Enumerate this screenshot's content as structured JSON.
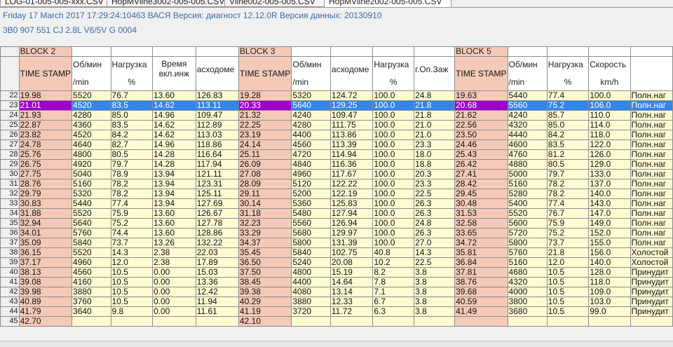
{
  "tabs": [
    "LOG-01-005-005-xxx.CSV",
    "HopMVline3002-005-005.CSV",
    "Vline002-005-005.CSV",
    "HopMVline2002-005-005.CSV"
  ],
  "info_line1": "Friday 17 March 2017 17:29:24:10463 ВАСЯ Версия: диагност 12.12.0R Версия данных: 20130910",
  "info_line2": "3B0 907 551 CJ  2.8L V6/5V     G   0004",
  "blocks": [
    "BLOCK 2",
    "BLOCK 3",
    "BLOCK 5"
  ],
  "time_label": "TIME STAMP",
  "columns": [
    {
      "name": "Об/мин",
      "unit": "/min"
    },
    {
      "name": "Нагрузка",
      "unit": "%"
    },
    {
      "name": "Время вкл.инж",
      "unit": ""
    },
    {
      "name": "асходоме",
      "unit": ""
    },
    {
      "name": "Об/мин",
      "unit": "/min"
    },
    {
      "name": "асходоме",
      "unit": ""
    },
    {
      "name": "Нагрузка",
      "unit": "%"
    },
    {
      "name": "г.Оп.Заж",
      "unit": ""
    },
    {
      "name": "Об/мин",
      "unit": "/min"
    },
    {
      "name": "Нагрузка",
      "unit": "%"
    },
    {
      "name": "Скорость",
      "unit": "km/h"
    }
  ],
  "selected_row": 23,
  "rows": [
    {
      "n": "22",
      "c": [
        "19.98",
        "5520",
        "76.7",
        "13.60",
        "126.83",
        "19.28",
        "5320",
        "124.72",
        "100.0",
        "24.8",
        "19.63",
        "5440",
        "77.4",
        "100.0",
        "Полн.наг"
      ]
    },
    {
      "n": "23",
      "c": [
        "21.01",
        "4520",
        "83.5",
        "14.62",
        "113.11",
        "20.33",
        "5640",
        "129.25",
        "100.0",
        "21.8",
        "20.68",
        "5560",
        "75.2",
        "106.0",
        "Полн.наг"
      ]
    },
    {
      "n": "24",
      "c": [
        "21.93",
        "4280",
        "85.0",
        "14.96",
        "109.47",
        "21.32",
        "4240",
        "109.47",
        "100.0",
        "21.8",
        "21.62",
        "4240",
        "85.7",
        "110.0",
        "Полн.наг"
      ]
    },
    {
      "n": "25",
      "c": [
        "22.87",
        "4360",
        "83.5",
        "14.62",
        "112.89",
        "22.25",
        "4280",
        "111.75",
        "100.0",
        "21.0",
        "22.56",
        "4320",
        "85.0",
        "114.0",
        "Полн.наг"
      ]
    },
    {
      "n": "26",
      "c": [
        "23.82",
        "4520",
        "84.2",
        "14.62",
        "113.03",
        "23.19",
        "4400",
        "113.86",
        "100.0",
        "21.0",
        "23.50",
        "4440",
        "84.2",
        "118.0",
        "Полн.наг"
      ]
    },
    {
      "n": "27",
      "c": [
        "24.78",
        "4640",
        "82.7",
        "14.96",
        "118.86",
        "24.14",
        "4560",
        "113.39",
        "100.0",
        "23.3",
        "24.46",
        "4600",
        "83.5",
        "122.0",
        "Полн.наг"
      ]
    },
    {
      "n": "28",
      "c": [
        "25.76",
        "4800",
        "80.5",
        "14.28",
        "116.64",
        "25.11",
        "4720",
        "114.94",
        "100.0",
        "18.0",
        "25.43",
        "4760",
        "81.2",
        "126.0",
        "Полн.наг"
      ]
    },
    {
      "n": "29",
      "c": [
        "26.75",
        "4920",
        "79.7",
        "14.28",
        "117.94",
        "26.09",
        "4840",
        "116.36",
        "100.0",
        "18.8",
        "26.42",
        "4880",
        "80.5",
        "129.0",
        "Полн.наг"
      ]
    },
    {
      "n": "30",
      "c": [
        "27.75",
        "5040",
        "78.9",
        "13.94",
        "121.11",
        "27.08",
        "4960",
        "117.67",
        "100.0",
        "20.3",
        "27.41",
        "5000",
        "79.7",
        "133.0",
        "Полн.наг"
      ]
    },
    {
      "n": "31",
      "c": [
        "28.76",
        "5160",
        "78.2",
        "13.94",
        "123.31",
        "28.09",
        "5120",
        "122.22",
        "100.0",
        "23.3",
        "28.42",
        "5160",
        "78.2",
        "137.0",
        "Полн.наг"
      ]
    },
    {
      "n": "32",
      "c": [
        "29.79",
        "5320",
        "78.2",
        "13.94",
        "125.11",
        "29.11",
        "5200",
        "122.19",
        "100.0",
        "22.5",
        "29.45",
        "5280",
        "78.2",
        "140.0",
        "Полн.наг"
      ]
    },
    {
      "n": "33",
      "c": [
        "30.83",
        "5440",
        "77.4",
        "13.94",
        "127.69",
        "30.14",
        "5360",
        "125.83",
        "100.0",
        "26.3",
        "30.48",
        "5400",
        "77.4",
        "143.0",
        "Полн.наг"
      ]
    },
    {
      "n": "34",
      "c": [
        "31.88",
        "5520",
        "75.9",
        "13.60",
        "126.67",
        "31.18",
        "5480",
        "127.94",
        "100.0",
        "26.3",
        "31.53",
        "5520",
        "76.7",
        "147.0",
        "Полн.наг"
      ]
    },
    {
      "n": "35",
      "c": [
        "32.94",
        "5640",
        "75.2",
        "13.60",
        "127.78",
        "32.23",
        "5560",
        "126.94",
        "100.0",
        "24.8",
        "32.58",
        "5600",
        "75.9",
        "149.0",
        "Полн.наг"
      ]
    },
    {
      "n": "36",
      "c": [
        "34.01",
        "5760",
        "74.4",
        "13.60",
        "128.86",
        "33.29",
        "5680",
        "129.97",
        "100.0",
        "26.3",
        "33.65",
        "5720",
        "75.2",
        "152.0",
        "Полн.наг"
      ]
    },
    {
      "n": "37",
      "c": [
        "35.09",
        "5840",
        "73.7",
        "13.26",
        "132.22",
        "34.37",
        "5800",
        "131.39",
        "100.0",
        "27.0",
        "34.72",
        "5800",
        "73.7",
        "155.0",
        "Полн.наг"
      ]
    },
    {
      "n": "38",
      "c": [
        "36.15",
        "5520",
        "14.3",
        "2.38",
        "22.03",
        "35.45",
        "5840",
        "102.75",
        "40.8",
        "14.3",
        "35.81",
        "5760",
        "21.8",
        "156.0",
        "Холостой"
      ]
    },
    {
      "n": "39",
      "c": [
        "37.17",
        "4960",
        "12.0",
        "2.38",
        "17.89",
        "36.50",
        "5240",
        "20.08",
        "10.2",
        "22.5",
        "36.84",
        "5160",
        "12.0",
        "140.0",
        "Холостой"
      ]
    },
    {
      "n": "40",
      "c": [
        "38.13",
        "4560",
        "10.5",
        "0.00",
        "15.03",
        "37.50",
        "4800",
        "15.19",
        "8.2",
        "3.8",
        "37.81",
        "4680",
        "10.5",
        "128.0",
        "Принудит"
      ]
    },
    {
      "n": "41",
      "c": [
        "39.08",
        "4160",
        "10.5",
        "0.00",
        "13.36",
        "38.45",
        "4400",
        "14.64",
        "7.8",
        "3.8",
        "38.76",
        "4320",
        "10.5",
        "118.0",
        "Принудит"
      ]
    },
    {
      "n": "42",
      "c": [
        "39.98",
        "3880",
        "10.5",
        "0.00",
        "12.42",
        "39.38",
        "4080",
        "13.14",
        "7.1",
        "3.8",
        "39.68",
        "4000",
        "10.5",
        "109.0",
        "Принудит"
      ]
    },
    {
      "n": "43",
      "c": [
        "40.89",
        "3760",
        "10.5",
        "0.00",
        "11.94",
        "40.29",
        "3880",
        "12.33",
        "6.7",
        "3.8",
        "40.59",
        "3800",
        "10.5",
        "103.0",
        "Принудит"
      ]
    },
    {
      "n": "44",
      "c": [
        "41.79",
        "3640",
        "9.8",
        "0.00",
        "11.61",
        "41.19",
        "3720",
        "11.72",
        "6.3",
        "3.8",
        "41.49",
        "3680",
        "10.5",
        "99.0",
        "Принудит"
      ]
    },
    {
      "n": "45",
      "c": [
        "42.70",
        "",
        "",
        "",
        "",
        "42.10",
        "",
        "",
        "",
        "",
        "",
        "",
        "",
        "",
        ""
      ]
    }
  ]
}
